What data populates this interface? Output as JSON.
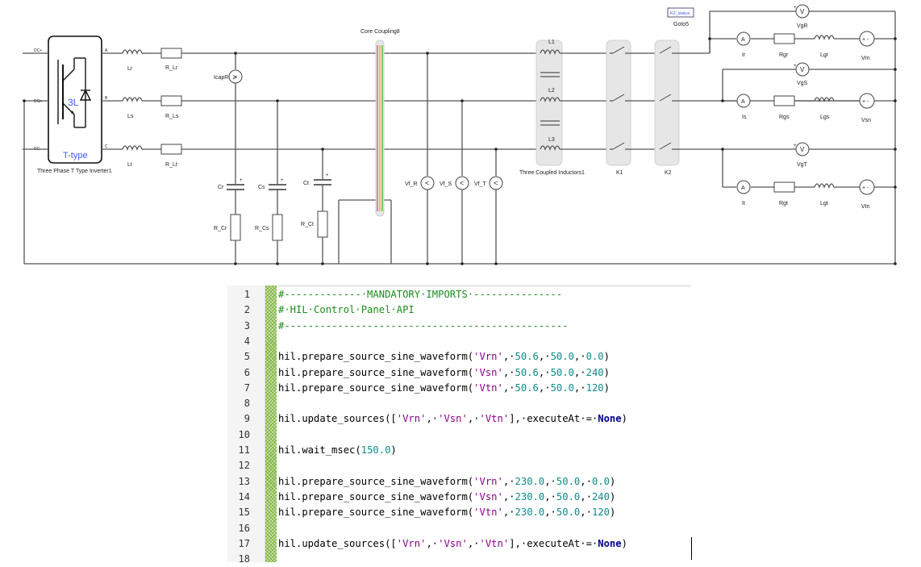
{
  "schematic": {
    "inverter": {
      "label_3l": "3L",
      "label_ttype": "T-type",
      "caption": "Three Phase T Type Inverter1",
      "pins": [
        "DC+",
        "DCn",
        "DC-"
      ],
      "phase_pins": [
        "A",
        "B",
        "C"
      ]
    },
    "phase_components": {
      "inductors": [
        "Lr",
        "Ls",
        "Lt"
      ],
      "resistors": [
        "R_Lr",
        "R_Ls",
        "R_Lt"
      ]
    },
    "current_source": "IcapR",
    "capacitors": [
      "Cr",
      "Cs",
      "Ct"
    ],
    "cap_resistors": [
      "R_Cr",
      "R_Cs",
      "R_Ct"
    ],
    "core_coupling": "Core Coupling8",
    "voltmeters_filter": [
      "Vf_R",
      "Vf_S",
      "Vf_T"
    ],
    "coupled_inductors": {
      "labels": [
        "L1",
        "L2",
        "L3"
      ],
      "caption": "Three Coupled Inductors1"
    },
    "contactors": [
      "K1",
      "K2"
    ],
    "goto": {
      "tag": "K2_status",
      "label": "Goto5"
    },
    "grid_voltmeters": [
      "VgR",
      "VgS",
      "VgT"
    ],
    "ammeters": [
      "Ir",
      "Is",
      "It"
    ],
    "grid_resistors": [
      "Rgr",
      "Rgs",
      "Rgt"
    ],
    "grid_inductors": [
      "Lgr",
      "Lgs",
      "Lgt"
    ],
    "grid_sources": [
      "Vrn",
      "Vsn",
      "Vtn"
    ],
    "meter_symbols": {
      "voltmeter": "V",
      "ammeter": "A",
      "plus": "+",
      "minus": "-"
    }
  },
  "editor": {
    "lines": [
      {
        "n": "1",
        "tokens": [
          [
            "cm",
            "#-------------·MANDATORY·IMPORTS·---------------"
          ]
        ]
      },
      {
        "n": "2",
        "tokens": [
          [
            "cm",
            "#·HIL·Control·Panel·API"
          ]
        ]
      },
      {
        "n": "3",
        "tokens": [
          [
            "cm",
            "#------------------------------------------------"
          ]
        ]
      },
      {
        "n": "4",
        "tokens": []
      },
      {
        "n": "5",
        "tokens": [
          [
            "fn",
            "hil.prepare_source_sine_waveform("
          ],
          [
            "st",
            "'Vrn'"
          ],
          [
            "pu",
            ",·"
          ],
          [
            "nm",
            "50.6"
          ],
          [
            "pu",
            ",·"
          ],
          [
            "nm",
            "50.0"
          ],
          [
            "pu",
            ",·"
          ],
          [
            "nm",
            "0.0"
          ],
          [
            "pu",
            ")"
          ]
        ]
      },
      {
        "n": "6",
        "tokens": [
          [
            "fn",
            "hil.prepare_source_sine_waveform("
          ],
          [
            "st",
            "'Vsn'"
          ],
          [
            "pu",
            ",·"
          ],
          [
            "nm",
            "50.6"
          ],
          [
            "pu",
            ",·"
          ],
          [
            "nm",
            "50.0"
          ],
          [
            "pu",
            ",·"
          ],
          [
            "nm",
            "240"
          ],
          [
            "pu",
            ")"
          ]
        ]
      },
      {
        "n": "7",
        "tokens": [
          [
            "fn",
            "hil.prepare_source_sine_waveform("
          ],
          [
            "st",
            "'Vtn'"
          ],
          [
            "pu",
            ",·"
          ],
          [
            "nm",
            "50.6"
          ],
          [
            "pu",
            ",·"
          ],
          [
            "nm",
            "50.0"
          ],
          [
            "pu",
            ",·"
          ],
          [
            "nm",
            "120"
          ],
          [
            "pu",
            ")"
          ]
        ]
      },
      {
        "n": "8",
        "tokens": []
      },
      {
        "n": "9",
        "tokens": [
          [
            "fn",
            "hil.update_sources(["
          ],
          [
            "st",
            "'Vrn'"
          ],
          [
            "pu",
            ",·"
          ],
          [
            "st",
            "'Vsn'"
          ],
          [
            "pu",
            ",·"
          ],
          [
            "st",
            "'Vtn'"
          ],
          [
            "pu",
            "],·executeAt·=·"
          ],
          [
            "kw",
            "None"
          ],
          [
            "pu",
            ")"
          ]
        ]
      },
      {
        "n": "10",
        "tokens": []
      },
      {
        "n": "11",
        "tokens": [
          [
            "fn",
            "hil.wait_msec("
          ],
          [
            "nm",
            "150.0"
          ],
          [
            "pu",
            ")"
          ]
        ]
      },
      {
        "n": "12",
        "tokens": []
      },
      {
        "n": "13",
        "tokens": [
          [
            "fn",
            "hil.prepare_source_sine_waveform("
          ],
          [
            "st",
            "'Vrn'"
          ],
          [
            "pu",
            ",·"
          ],
          [
            "nm",
            "230.0"
          ],
          [
            "pu",
            ",·"
          ],
          [
            "nm",
            "50.0"
          ],
          [
            "pu",
            ",·"
          ],
          [
            "nm",
            "0.0"
          ],
          [
            "pu",
            ")"
          ]
        ]
      },
      {
        "n": "14",
        "tokens": [
          [
            "fn",
            "hil.prepare_source_sine_waveform("
          ],
          [
            "st",
            "'Vsn'"
          ],
          [
            "pu",
            ",·"
          ],
          [
            "nm",
            "230.0"
          ],
          [
            "pu",
            ",·"
          ],
          [
            "nm",
            "50.0"
          ],
          [
            "pu",
            ",·"
          ],
          [
            "nm",
            "240"
          ],
          [
            "pu",
            ")"
          ]
        ]
      },
      {
        "n": "15",
        "tokens": [
          [
            "fn",
            "hil.prepare_source_sine_waveform("
          ],
          [
            "st",
            "'Vtn'"
          ],
          [
            "pu",
            ",·"
          ],
          [
            "nm",
            "230.0"
          ],
          [
            "pu",
            ",·"
          ],
          [
            "nm",
            "50.0"
          ],
          [
            "pu",
            ",·"
          ],
          [
            "nm",
            "120"
          ],
          [
            "pu",
            ")"
          ]
        ]
      },
      {
        "n": "16",
        "tokens": []
      },
      {
        "n": "17",
        "tokens": [
          [
            "fn",
            "hil.update_sources(["
          ],
          [
            "st",
            "'Vrn'"
          ],
          [
            "pu",
            ",·"
          ],
          [
            "st",
            "'Vsn'"
          ],
          [
            "pu",
            ",·"
          ],
          [
            "st",
            "'Vtn'"
          ],
          [
            "pu",
            "],·executeAt·=·"
          ],
          [
            "kw",
            "None"
          ],
          [
            "pu",
            ")"
          ]
        ]
      },
      {
        "n": "18",
        "tokens": []
      }
    ]
  },
  "colors": {
    "accent": "#3d5afe",
    "fold_bar": "#7fb43f",
    "comment": "#1c8c1c",
    "string": "#8b008b",
    "number": "#0e8c8c",
    "keyword": "#00008b"
  }
}
